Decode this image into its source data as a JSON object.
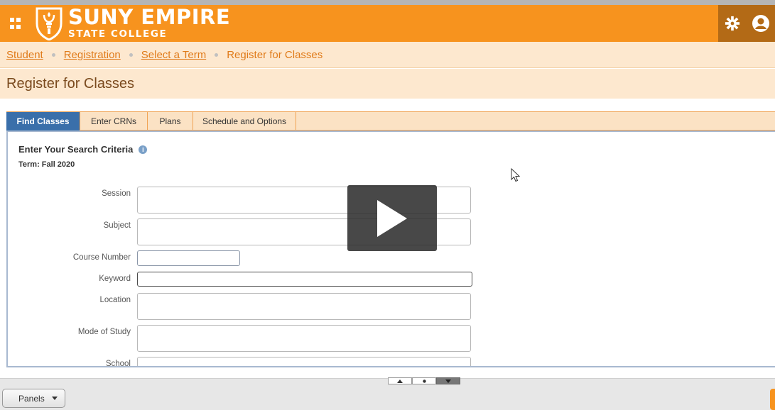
{
  "header": {
    "logo_main": "SUNY EMPIRE",
    "logo_sub": "STATE COLLEGE",
    "settings_icon": "gear-icon",
    "user_icon": "user-icon",
    "apps_icon": "apps-grid-icon",
    "brand_color": "#f7931e"
  },
  "breadcrumb": {
    "items": [
      {
        "label": "Student"
      },
      {
        "label": "Registration"
      },
      {
        "label": "Select a Term"
      }
    ],
    "current": "Register for Classes"
  },
  "page": {
    "title": "Register for Classes"
  },
  "tabs": [
    {
      "label": "Find Classes",
      "active": true
    },
    {
      "label": "Enter CRNs",
      "active": false
    },
    {
      "label": "Plans",
      "active": false
    },
    {
      "label": "Schedule and Options",
      "active": false
    }
  ],
  "search": {
    "heading": "Enter Your Search Criteria",
    "term": "Term: Fall 2020",
    "fields": [
      {
        "label": "Session",
        "value": ""
      },
      {
        "label": "Subject",
        "value": ""
      },
      {
        "label": "Course Number",
        "value": ""
      },
      {
        "label": "Keyword",
        "value": ""
      },
      {
        "label": "Location",
        "value": ""
      },
      {
        "label": "Mode of Study",
        "value": ""
      },
      {
        "label": "School",
        "value": ""
      }
    ]
  },
  "video": {
    "play_icon": "play-icon"
  },
  "footer": {
    "panels_label": "Panels"
  }
}
